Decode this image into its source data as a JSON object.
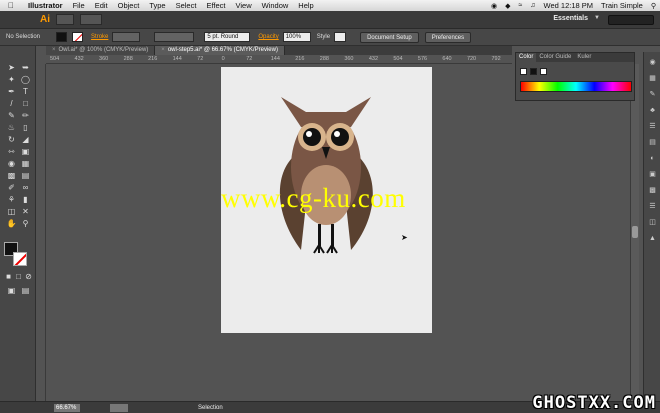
{
  "menubar": {
    "app_name": "Illustrator",
    "items": [
      "File",
      "Edit",
      "Object",
      "Type",
      "Select",
      "Effect",
      "View",
      "Window",
      "Help"
    ],
    "clock": "Wed 12:18 PM",
    "user": "Train Simple"
  },
  "appbar": {
    "logo": "Ai",
    "workspace": "Essentials",
    "search_placeholder": ""
  },
  "controlbar": {
    "selection": "No Selection",
    "stroke_label": "Stroke",
    "brush": "5 pt. Round",
    "opacity_label": "Opacity",
    "opacity_value": "100%",
    "style_label": "Style",
    "document_setup": "Document Setup",
    "preferences": "Preferences"
  },
  "tabs": [
    {
      "label": "Owl.ai* @ 100% (CMYK/Preview)",
      "active": false
    },
    {
      "label": "owl-step5.ai* @ 66.67% (CMYK/Preview)",
      "active": true
    }
  ],
  "ruler_ticks": [
    "504",
    "432",
    "360",
    "288",
    "216",
    "144",
    "72",
    "0",
    "72",
    "144",
    "216",
    "288",
    "360",
    "432",
    "504",
    "576",
    "640",
    "720",
    "792"
  ],
  "color_panel": {
    "tabs": [
      "Color",
      "Color Guide",
      "Kuler"
    ],
    "active_tab": "Color"
  },
  "statusbar": {
    "zoom": "66.67%",
    "artboard": "1",
    "status": "Selection"
  },
  "overlay_text": "www.cg-ku.com",
  "watermark": "GHOSTXX.COM",
  "colors": {
    "owl_body": "#7a5645",
    "owl_belly": "#b89073",
    "owl_wing": "#5a4130",
    "owl_eye_ring": "#d8b48c",
    "accent": "#ff9a00"
  }
}
